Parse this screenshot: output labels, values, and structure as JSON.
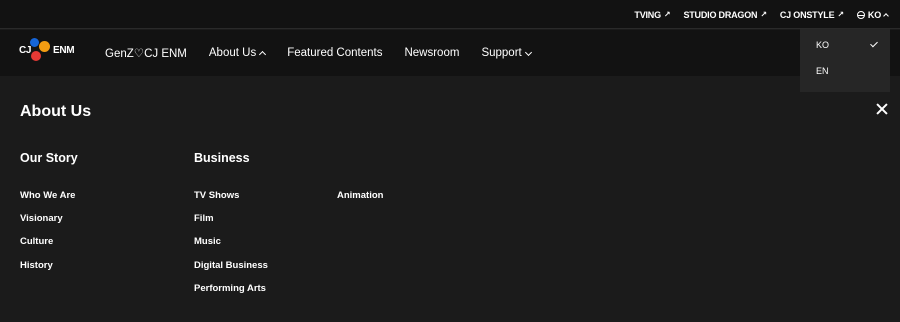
{
  "topbar": {
    "links": [
      "TVING",
      "STUDIO DRAGON",
      "CJ ONSTYLE"
    ],
    "lang_label": "KO"
  },
  "logo": {
    "left": "CJ",
    "right": "ENM"
  },
  "nav": {
    "items": [
      "GenZ♡CJ ENM",
      "About Us",
      "Featured Contents",
      "Newsroom",
      "Support"
    ]
  },
  "panel": {
    "title": "About Us",
    "our_story": {
      "heading": "Our Story",
      "links": [
        "Who We Are",
        "Visionary",
        "Culture",
        "History"
      ]
    },
    "business": {
      "heading": "Business",
      "links_col1": [
        "TV Shows",
        "Film",
        "Music",
        "Digital Business",
        "Performing Arts"
      ],
      "links_col2": [
        "Animation"
      ]
    }
  },
  "lang_menu": {
    "options": [
      "KO",
      "EN"
    ],
    "selected": "KO"
  }
}
